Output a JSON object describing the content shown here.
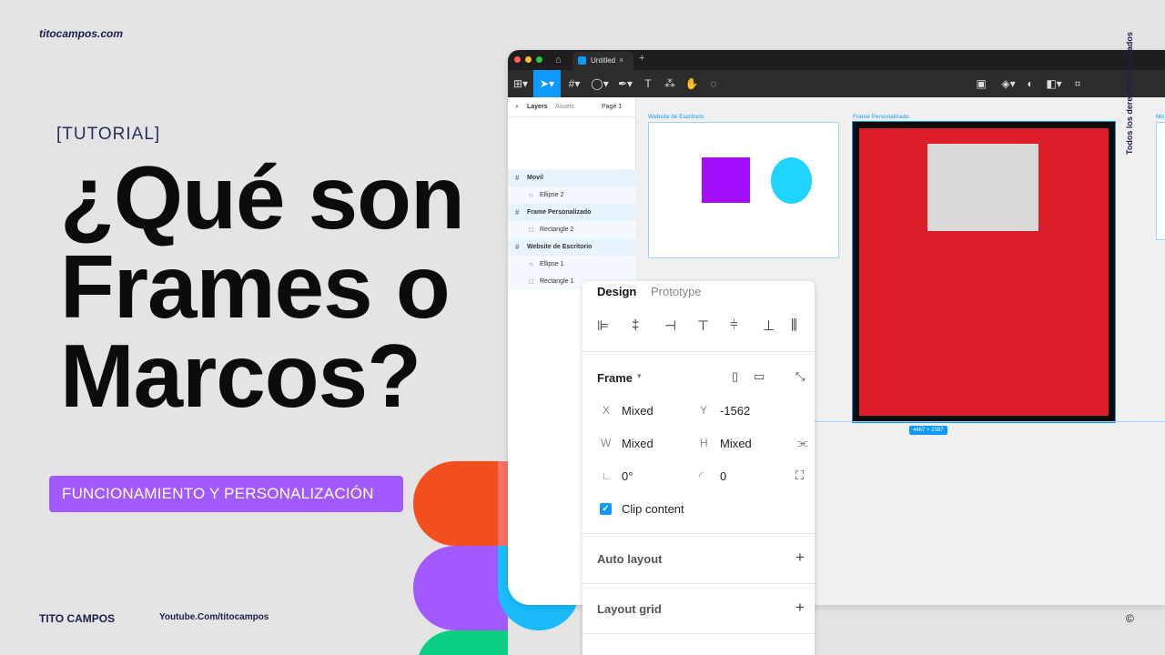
{
  "poster": {
    "brand_top": "titocampos.com",
    "tag": "[TUTORIAL]",
    "headline": "¿Qué son Frames o Marcos?",
    "pill": "FUNCIONAMIENTO Y PERSONALIZACIÓN",
    "brand_bottom": "TITO CAMPOS",
    "youtube": "Youtube.Com/titocampos",
    "vertical_text": "Todos los derechos reservados",
    "copyright": "©"
  },
  "window": {
    "tab_title": "Untitled",
    "tab_close": "×",
    "new_tab": "+"
  },
  "layers_panel": {
    "tab_layers": "Layers",
    "tab_assets": "Assets",
    "page_selector": "Page 1",
    "items": [
      {
        "label": "Movil",
        "kind": "frame"
      },
      {
        "label": "Ellipse 2",
        "kind": "child"
      },
      {
        "label": "Frame Personalizado",
        "kind": "frame"
      },
      {
        "label": "Rectangle 2",
        "kind": "child"
      },
      {
        "label": "Website de Escritorio",
        "kind": "frame"
      },
      {
        "label": "Ellipse 1",
        "kind": "child"
      },
      {
        "label": "Rectangle 1",
        "kind": "child"
      }
    ]
  },
  "canvas": {
    "frame_labels": [
      "Website de Escritorio",
      "Frame Personalizado",
      "Mo"
    ],
    "size_badge": "4467 × 2387",
    "colors": {
      "square": "#a30ffd",
      "ellipse": "#1fd5ff",
      "custom_frame_fill": "#dc1e2b",
      "custom_frame_border": "#0b0b0b",
      "inner_rect": "#d9d9d9"
    }
  },
  "design_panel": {
    "tab_design": "Design",
    "tab_prototype": "Prototype",
    "frame_title": "Frame",
    "x_label": "X",
    "x_value": "Mixed",
    "y_label": "Y",
    "y_value": "-1562",
    "w_label": "W",
    "w_value": "Mixed",
    "h_label": "H",
    "h_value": "Mixed",
    "rotation_value": "0°",
    "radius_value": "0",
    "clip_content": "Clip content",
    "auto_layout": "Auto layout",
    "layout_grid": "Layout grid"
  },
  "accent_colors": {
    "figma_blue": "#0d99ff",
    "pill_purple": "#a259ff"
  }
}
